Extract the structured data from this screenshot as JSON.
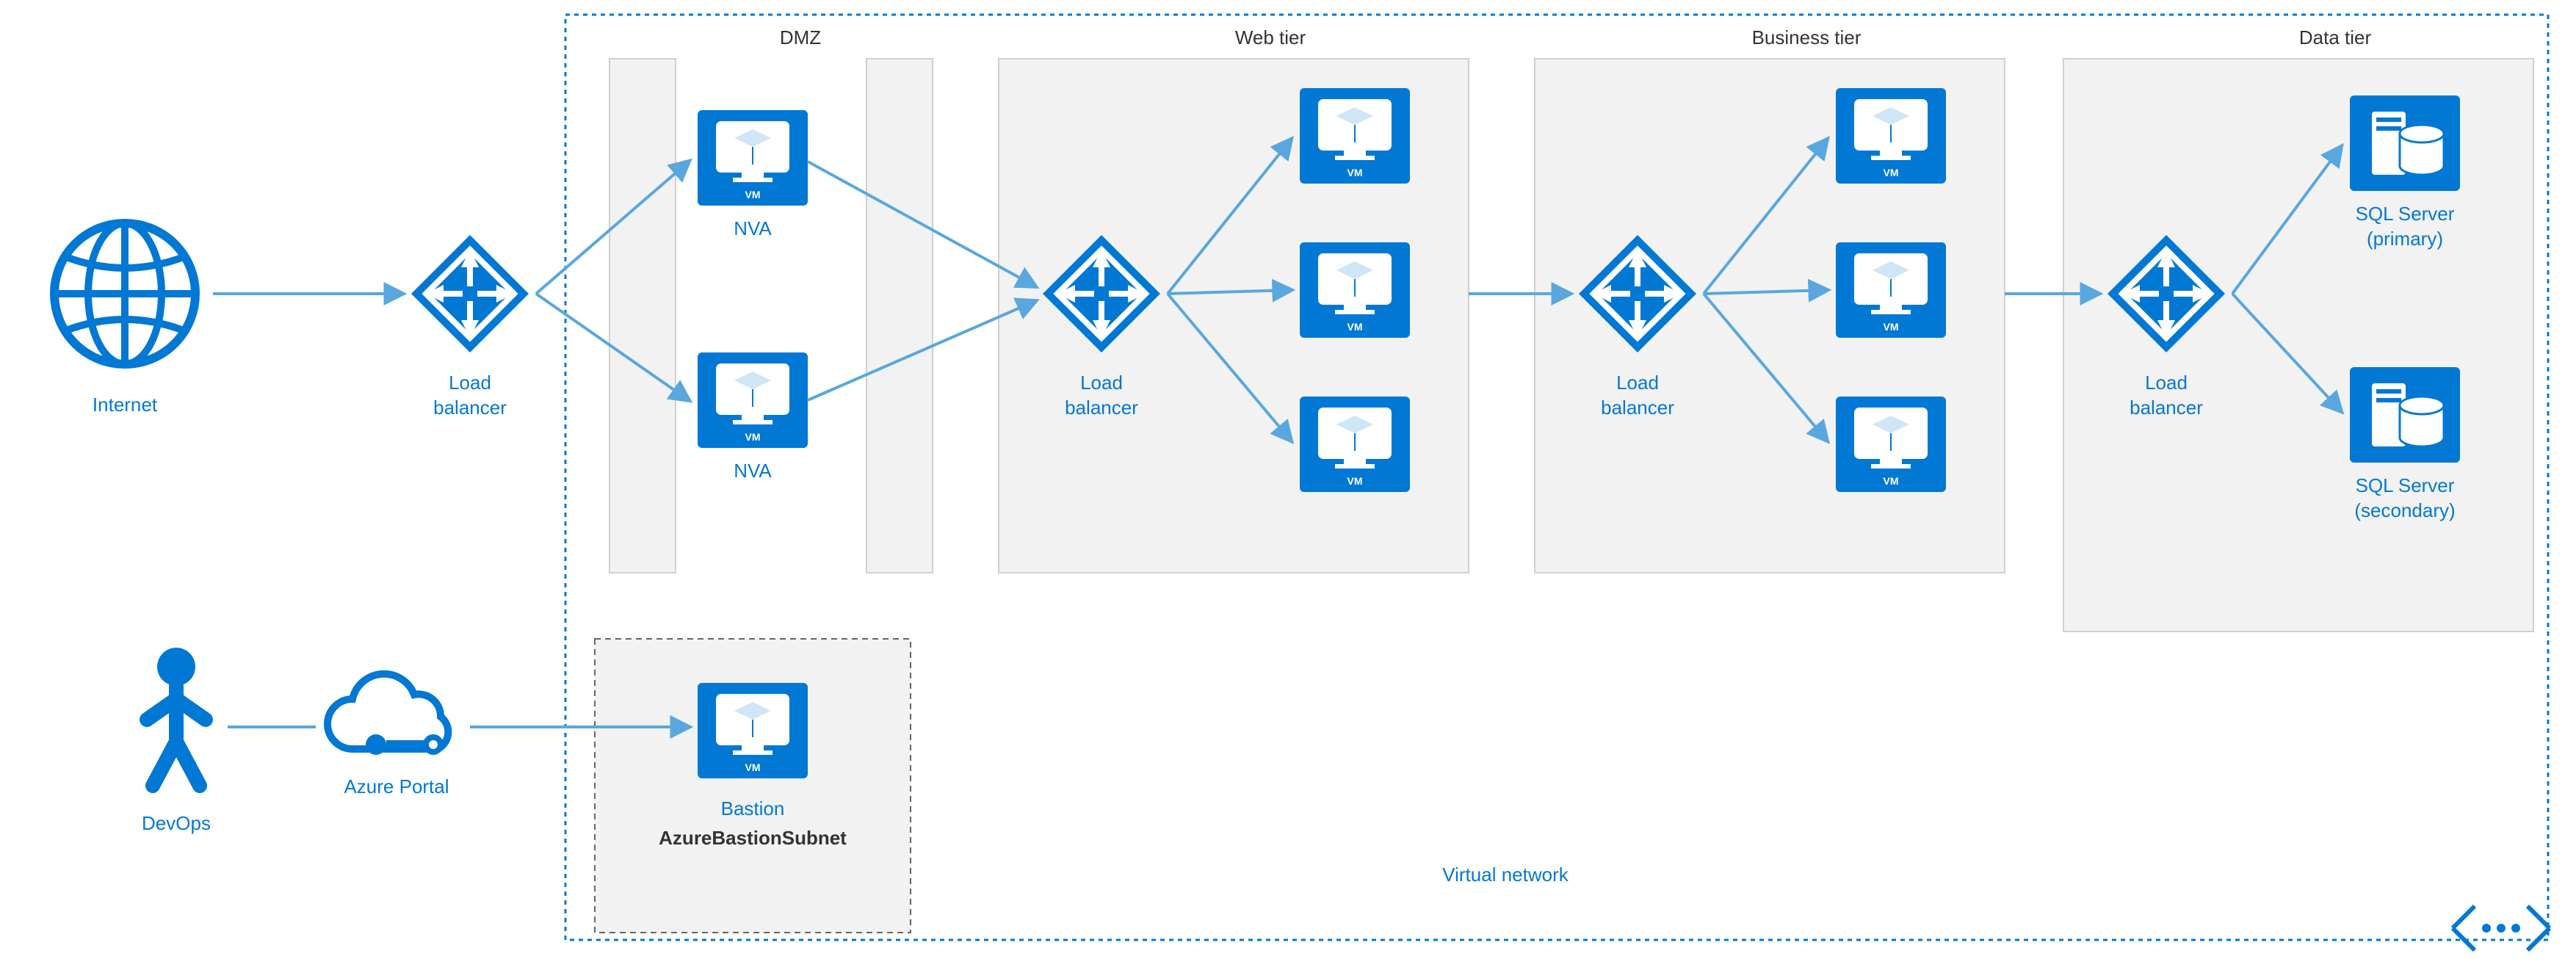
{
  "labels": {
    "internet": "Internet",
    "devops": "DevOps",
    "azure_portal": "Azure Portal",
    "bastion": "Bastion",
    "bastion_subnet": "AzureBastionSubnet",
    "vnet": "Virtual network",
    "lb": "Load\nbalancer",
    "nva": "NVA",
    "sql_primary": "SQL Server\n(primary)",
    "sql_secondary": "SQL Server\n(secondary)",
    "vm_badge": "VM"
  },
  "tiers": {
    "dmz": "DMZ",
    "web": "Web tier",
    "business": "Business tier",
    "data": "Data tier"
  },
  "colors": {
    "azure": "#0078d4",
    "light": "#59a7de",
    "panel": "#f2f2f2"
  }
}
